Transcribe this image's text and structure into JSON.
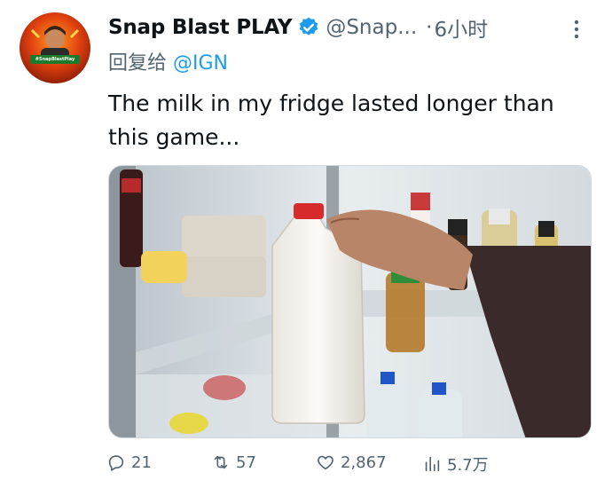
{
  "author": {
    "display_name": "Snap Blast PLAY",
    "handle": "@Snap...",
    "separator": "·",
    "time": "6小时",
    "avatar_badge": "#SnapBlastPlay"
  },
  "reply": {
    "prefix": "回复给",
    "mention": "@IGN"
  },
  "tweet": {
    "text": "The milk in my fridge lasted longer than this game..."
  },
  "actions": {
    "replies": "21",
    "retweets": "57",
    "likes": "2,867",
    "views": "5.7万"
  },
  "colors": {
    "accent": "#1d9bf0",
    "muted": "#536471",
    "text": "#0f1419"
  }
}
